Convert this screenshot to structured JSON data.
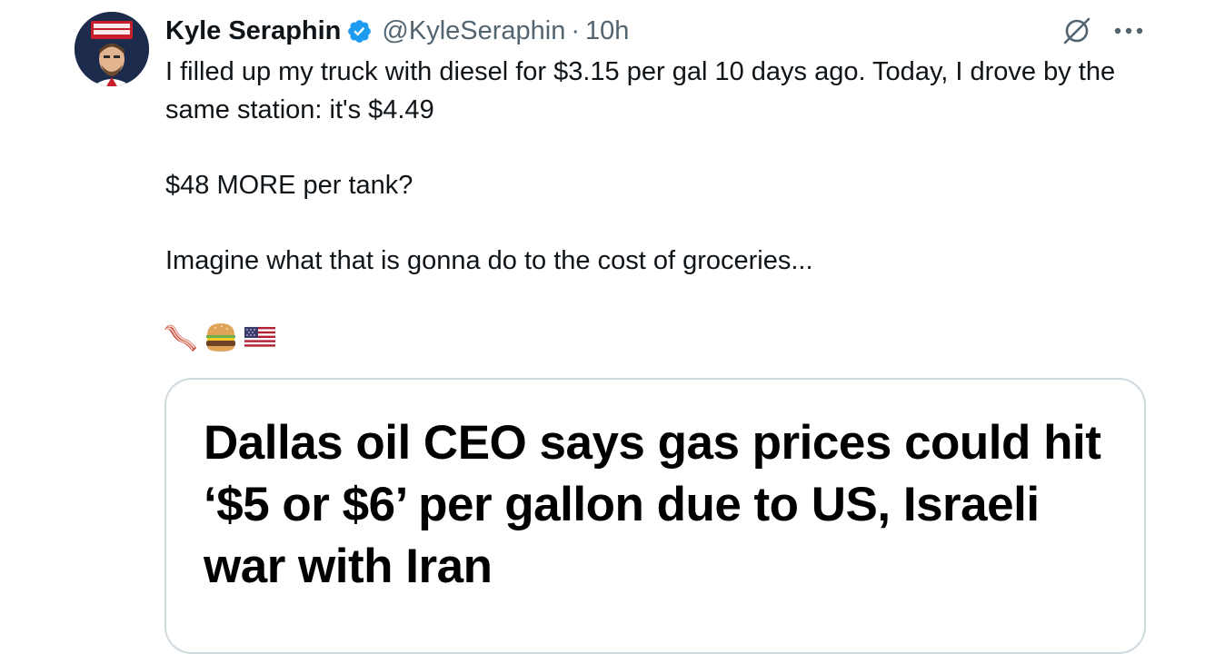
{
  "tweet": {
    "author": {
      "display_name": "Kyle Seraphin",
      "handle": "@KyleSeraphin",
      "verified": true,
      "avatar_logo_text": "KYLE SERAPHIN SHOW"
    },
    "separator": "·",
    "time": "10h",
    "text_lines": [
      "I filled up my truck with diesel for $3.15 per gal 10 days ago. Today, I drove by the same station:  it's $4.49",
      "$48 MORE per tank?",
      "Imagine what that is gonna do to the cost of groceries..."
    ],
    "emojis": [
      "bacon",
      "hamburger",
      "us-flag"
    ],
    "media": {
      "headline": "Dallas oil CEO says gas prices could hit ‘$5 or $6’ per gallon due to US, Israeli war with Iran"
    },
    "icons": {
      "verified": "verified-badge-icon",
      "grok": "grok-icon",
      "more": "more-icon"
    },
    "colors": {
      "text": "#0f1419",
      "secondary": "#536471",
      "verified": "#1d9bf0",
      "border": "#cfd9de"
    }
  }
}
